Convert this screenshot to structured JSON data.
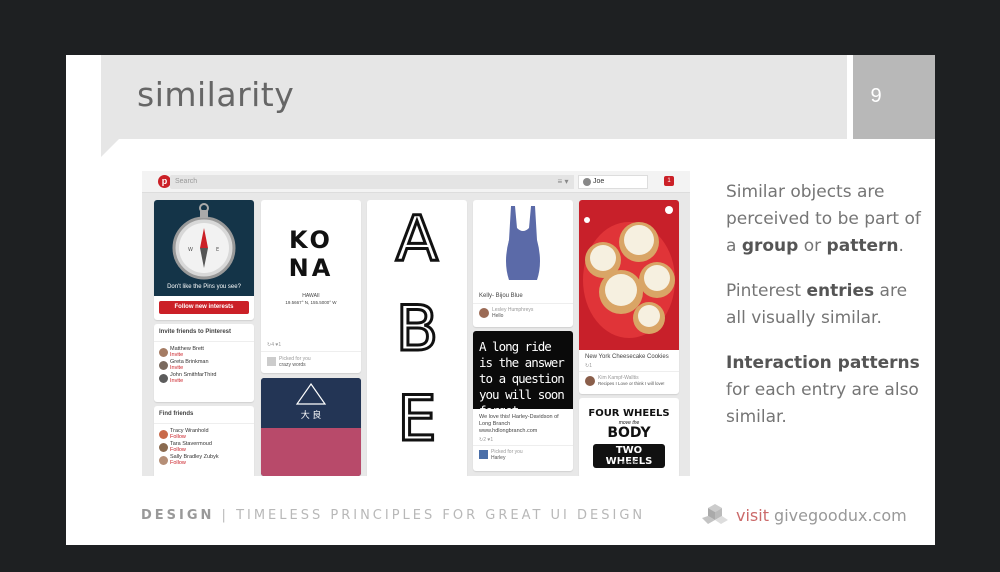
{
  "slide": {
    "title": "similarity",
    "number": "9"
  },
  "pinterest": {
    "search_placeholder": "Search",
    "menu_glyph": "≡ ▾",
    "user_name": "Joe",
    "notification_count": "1",
    "compass_caption": "Don't like the Pins you see?",
    "follow_button": "Follow new interests",
    "invite_heading": "Invite friends to Pinterest",
    "invite_friends": [
      {
        "name": "Matthew Brett",
        "action": "Invite"
      },
      {
        "name": "Greta Brinkman",
        "action": "Invite"
      },
      {
        "name": "John SmithfarThird",
        "action": "Invite"
      }
    ],
    "find_heading": "Find friends",
    "find_friends": [
      {
        "name": "Tracy Wranhold",
        "action": "Follow"
      },
      {
        "name": "Tara Stavermoud",
        "action": "Follow"
      },
      {
        "name": "Sally Bradley Zubyk",
        "action": "Follow"
      }
    ],
    "kona_title_1": "KO",
    "kona_title_2": "NA",
    "kona_sub": "HAWAII",
    "kona_coords": "19.5667° N, 155.5000° W",
    "kona_stats": "↻4  ♥1",
    "kona_picked": "Picked for you",
    "kona_board": "crazy words",
    "abe_letters": [
      "A",
      "B",
      "E"
    ],
    "swimsuit_caption": "Kelly- Bijou Blue",
    "swimsuit_user": "Lesley Humphreys",
    "swimsuit_board": "Hello",
    "quote_text": "A long ride is the answer to a question you will soon forget.",
    "quote_caption": "We love this! Harley-Davidson of Long Branch www.hdlongbranch.com",
    "quote_stats": "↻2  ♥1",
    "quote_picked": "Picked for you",
    "quote_board": "Harley",
    "cheesecake_caption": "New York Cheesecake Cookies",
    "cheesecake_stats": "↻1",
    "cheesecake_user": "Kim Kampf-Walltis",
    "cheesecake_board": "Recipes I Love or think I will love!",
    "wheels_line1": "FOUR WHEELS",
    "wheels_line2": "move the",
    "wheels_line3": "BODY",
    "wheels_line4": "TWO WHEELS",
    "wheels_line5": "move the",
    "cloud_sign": "大 良"
  },
  "bullets": {
    "p1_a": "Similar objects are perceived to be part of a ",
    "p1_b": "group",
    "p1_c": " or ",
    "p1_d": "pattern",
    "p1_e": ".",
    "p2_a": "Pinterest ",
    "p2_b": "entries",
    "p2_c": " are all visually similar.",
    "p3_a": "Interaction patterns",
    "p3_b": " for each entry are also similar."
  },
  "footer": {
    "brand": "DESIGN",
    "tagline": " | TIMELESS PRINCIPLES FOR GREAT UI DESIGN",
    "visit_label": "visit",
    "site": " givegoodux.com"
  },
  "colors": {
    "pinterest_red": "#cb2027",
    "title_band": "#e6e6e6",
    "number_band": "#b8b8b8",
    "background": "#1e2022"
  },
  "icons": [
    "pinterest-logo-icon",
    "menu-icon",
    "compass-icon",
    "givegoodux-logo-icon"
  ]
}
